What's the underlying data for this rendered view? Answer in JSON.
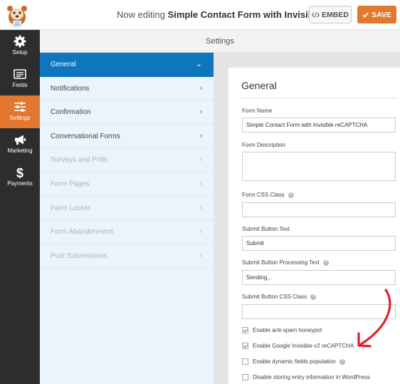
{
  "header": {
    "editing_prefix": "Now editing",
    "form_title": "Simple Contact Form with Invisible..",
    "embed_label": "EMBED",
    "save_label": "SAVE",
    "brand_color": "#e27730"
  },
  "sidebar": {
    "items": [
      {
        "label": "Setup",
        "icon": "gear-icon"
      },
      {
        "label": "Fields",
        "icon": "fields-icon"
      },
      {
        "label": "Settings",
        "icon": "sliders-icon",
        "active": true
      },
      {
        "label": "Marketing",
        "icon": "megaphone-icon"
      },
      {
        "label": "Payments",
        "icon": "dollar-icon"
      }
    ]
  },
  "settings_header": "Settings",
  "panel": {
    "items": [
      {
        "label": "General",
        "state": "active"
      },
      {
        "label": "Notifications",
        "state": "normal"
      },
      {
        "label": "Confirmation",
        "state": "normal"
      },
      {
        "label": "Conversational Forms",
        "state": "normal"
      },
      {
        "label": "Surveys and Polls",
        "state": "disabled"
      },
      {
        "label": "Form Pages",
        "state": "disabled"
      },
      {
        "label": "Form Locker",
        "state": "disabled"
      },
      {
        "label": "Form Abandonment",
        "state": "disabled"
      },
      {
        "label": "Post Submissions",
        "state": "disabled"
      }
    ],
    "active_color": "#0e76bc"
  },
  "general": {
    "title": "General",
    "form_name_label": "Form Name",
    "form_name_value": "Simple Contact Form with Invisible reCAPTCHA",
    "form_description_label": "Form Description",
    "form_css_class_label": "Form CSS Class",
    "submit_text_label": "Submit Button Text",
    "submit_text_value": "Submit",
    "processing_text_label": "Submit Button Processing Text",
    "processing_text_value": "Sending...",
    "submit_css_label": "Submit Button CSS Class",
    "checkboxes": [
      {
        "label": "Enable anti-spam honeypot",
        "checked": true
      },
      {
        "label": "Enable Google Invisible v2 reCAPTCHA",
        "checked": true
      },
      {
        "label": "Enable dynamic fields population",
        "checked": false
      },
      {
        "label": "Disable storing entry information in WordPress",
        "checked": false
      }
    ]
  },
  "annotation_color": "#e0202a"
}
